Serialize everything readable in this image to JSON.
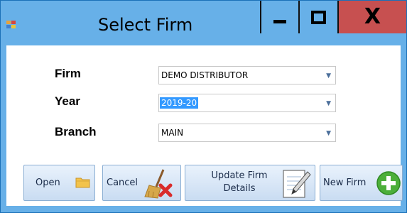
{
  "window": {
    "title": "Select Firm",
    "controls": {
      "minimize": "minimize",
      "maximize": "maximize",
      "close": "close"
    }
  },
  "form": {
    "firm": {
      "label": "Firm",
      "value": "DEMO DISTRIBUTOR"
    },
    "year": {
      "label": "Year",
      "value": "2019-20",
      "selected": true
    },
    "branch": {
      "label": "Branch",
      "value": "MAIN"
    }
  },
  "buttons": {
    "open": {
      "label": "Open",
      "icon": "folder-icon"
    },
    "cancel": {
      "label": "Cancel",
      "icon": "broom-cancel-icon"
    },
    "update": {
      "label_line1": "Update Firm",
      "label_line2": "Details",
      "icon": "notepad-pencil-icon"
    },
    "new": {
      "label": "New Firm",
      "icon": "plus-circle-icon"
    }
  },
  "colors": {
    "title_bar": "#67b0e8",
    "close_button": "#c75050",
    "selection": "#3399ff",
    "button_gradient_top": "#e9f2fc",
    "button_gradient_bottom": "#c9dcf2",
    "plus_circle": "#4caf3a"
  }
}
